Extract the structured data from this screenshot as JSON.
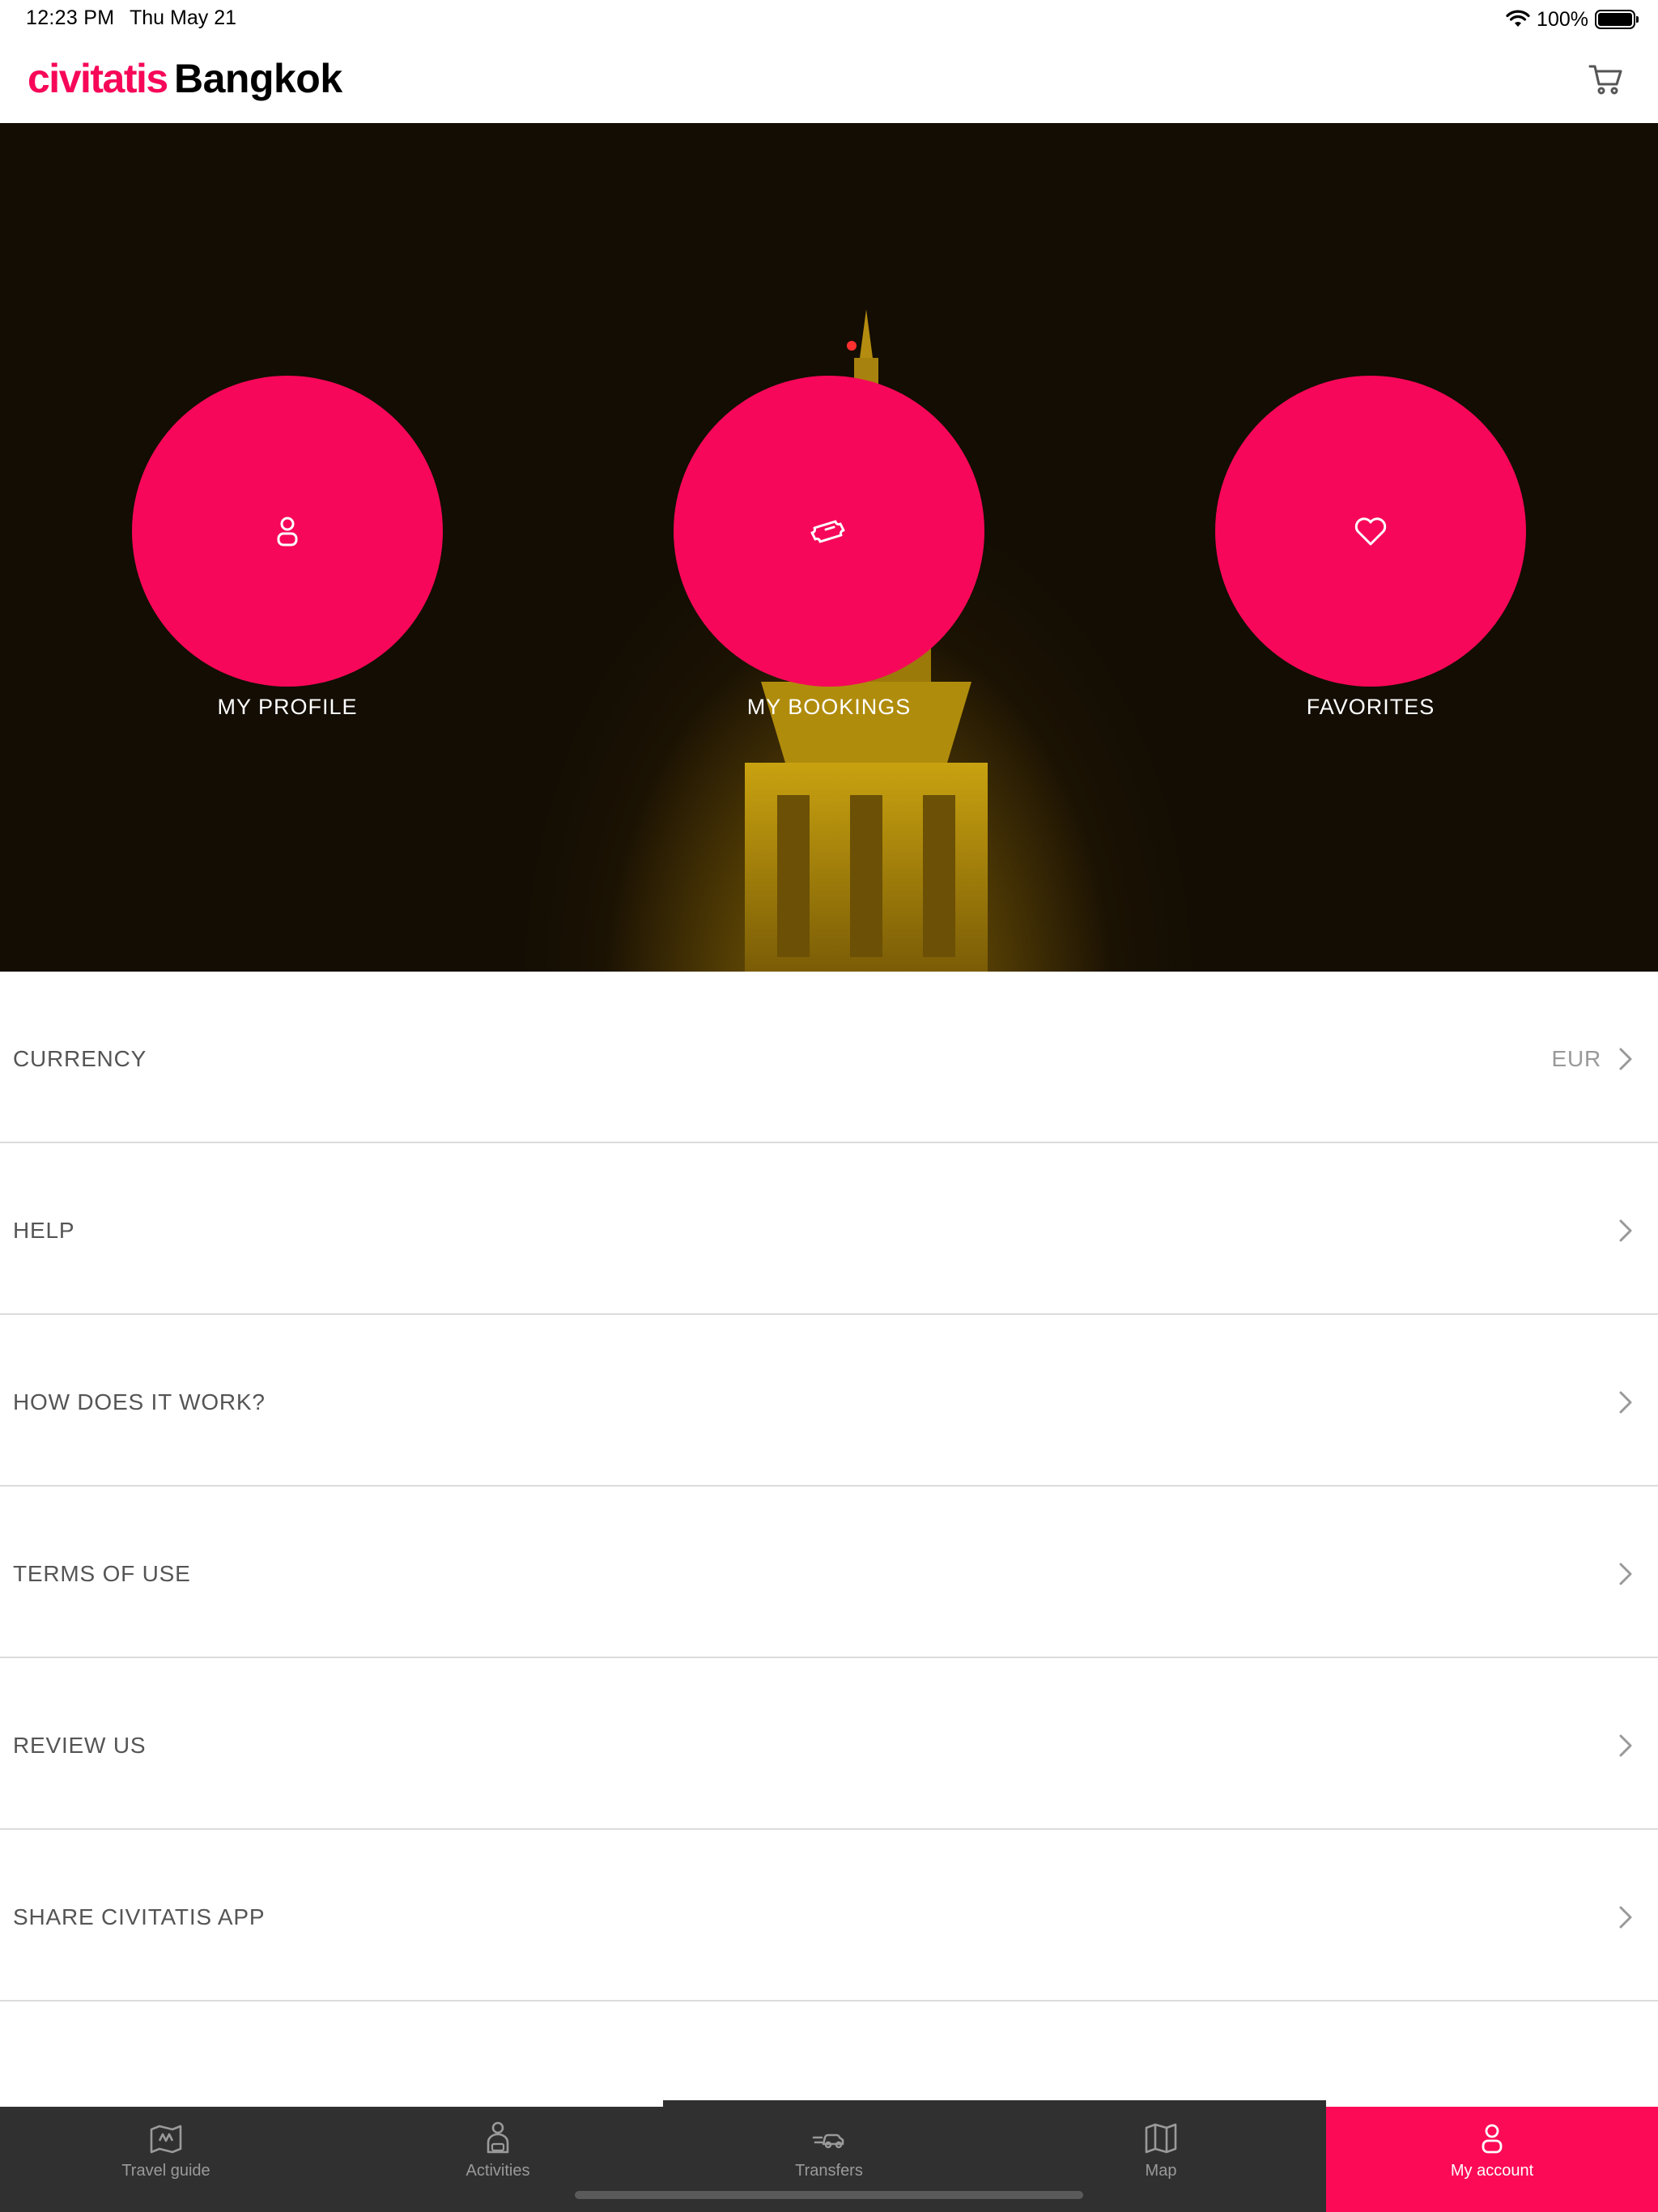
{
  "status_bar": {
    "time": "12:23 PM",
    "date": "Thu May 21",
    "battery": "100%",
    "icons": [
      "wifi-icon",
      "battery-icon"
    ]
  },
  "header": {
    "logo": "civitatis",
    "city": "Bangkok",
    "cart_icon": "cart-icon"
  },
  "hero": {
    "buttons": [
      {
        "label": "MY PROFILE",
        "icon": "user-icon"
      },
      {
        "label": "MY BOOKINGS",
        "icon": "ticket-icon"
      },
      {
        "label": "FAVORITES",
        "icon": "heart-icon"
      }
    ]
  },
  "menu": {
    "items": [
      {
        "label": "CURRENCY",
        "value": "EUR"
      },
      {
        "label": "HELP",
        "value": ""
      },
      {
        "label": "HOW DOES IT WORK?",
        "value": ""
      },
      {
        "label": "TERMS OF USE",
        "value": ""
      },
      {
        "label": "REVIEW US",
        "value": ""
      },
      {
        "label": "SHARE CIVITATIS APP",
        "value": ""
      }
    ]
  },
  "tabs": {
    "items": [
      {
        "label": "Travel guide",
        "icon": "map-guide-icon"
      },
      {
        "label": "Activities",
        "icon": "activities-icon"
      },
      {
        "label": "Transfers",
        "icon": "transfers-icon"
      },
      {
        "label": "Map",
        "icon": "map-icon"
      },
      {
        "label": "My account",
        "icon": "user-icon"
      }
    ],
    "active": "My account"
  },
  "colors": {
    "brand": "#f70759",
    "tab_bar": "#303030",
    "tab_active": "#fd0a57"
  }
}
